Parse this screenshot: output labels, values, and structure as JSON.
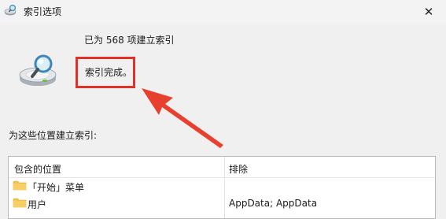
{
  "window": {
    "title": "索引选项",
    "close_glyph": "✕"
  },
  "status": {
    "count_line": "已为 568 项建立索引",
    "state_line": "索引完成。"
  },
  "annotation": {
    "box_color": "#e0302a",
    "arrow_color": "#e8402f"
  },
  "locations_label": "为这些位置建立索引:",
  "list": {
    "headers": {
      "included": "包含的位置",
      "exclude": "排除"
    },
    "rows": [
      {
        "icon": "folder-icon",
        "name": "「开始」菜单",
        "exclude": ""
      },
      {
        "icon": "folder-icon",
        "name": "用户",
        "exclude": "AppData; AppData"
      }
    ]
  },
  "colors": {
    "folder": "#f5c24b",
    "window_bg": "#f0f0f0"
  }
}
